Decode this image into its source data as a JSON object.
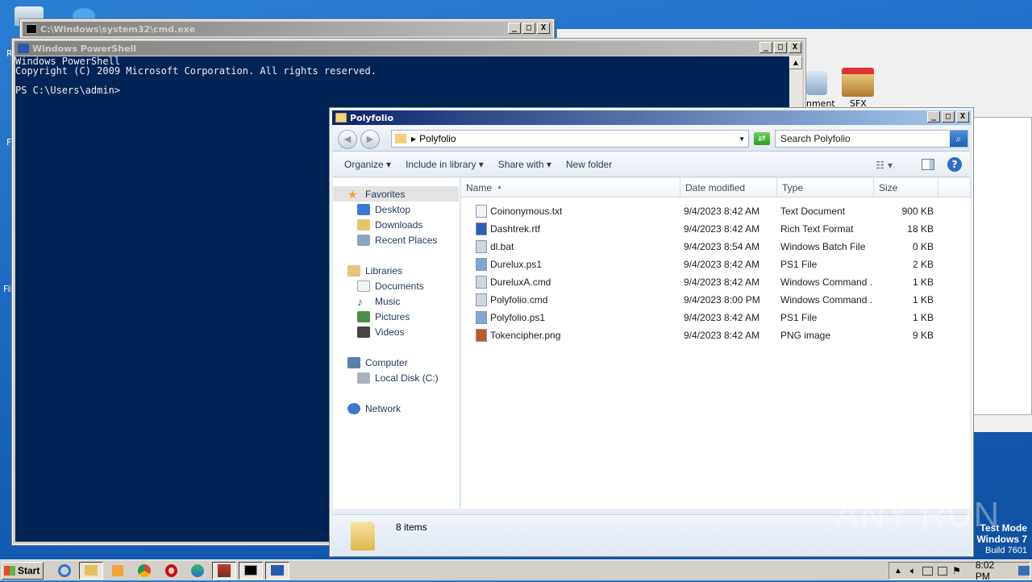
{
  "desktop": {
    "icon_labels": [
      "SFX",
      "nment"
    ],
    "left_fragments": [
      "R",
      "F",
      "Fil"
    ]
  },
  "cmd_window": {
    "title": "C:\\Windows\\system32\\cmd.exe",
    "buttons": [
      "_",
      "□",
      "X"
    ]
  },
  "powershell": {
    "title": "Windows PowerShell",
    "lines": [
      "Windows PowerShell",
      "Copyright (C) 2009 Microsoft Corporation. All rights reserved.",
      "",
      "PS C:\\Users\\admin>"
    ]
  },
  "explorer": {
    "title": "Polyfolio",
    "address": "Polyfolio",
    "search_placeholder": "Search Polyfolio",
    "toolbar": {
      "organize": "Organize",
      "include": "Include in library",
      "share": "Share with",
      "new_folder": "New folder"
    },
    "nav": {
      "favorites": "Favorites",
      "desktop": "Desktop",
      "downloads": "Downloads",
      "recent": "Recent Places",
      "libraries": "Libraries",
      "documents": "Documents",
      "music": "Music",
      "pictures": "Pictures",
      "videos": "Videos",
      "computer": "Computer",
      "local_disk": "Local Disk (C:)",
      "network": "Network"
    },
    "columns": [
      "Name",
      "Date modified",
      "Type",
      "Size"
    ],
    "files": [
      {
        "name": "Coinonymous.txt",
        "date": "9/4/2023 8:42 AM",
        "type": "Text Document",
        "size": "900 KB",
        "icon": "text-file-icon"
      },
      {
        "name": "Dashtrek.rtf",
        "date": "9/4/2023 8:42 AM",
        "type": "Rich Text Format",
        "size": "18 KB",
        "icon": "rtf-file-icon"
      },
      {
        "name": "dl.bat",
        "date": "9/4/2023 8:54 AM",
        "type": "Windows Batch File",
        "size": "0 KB",
        "icon": "batch-file-icon"
      },
      {
        "name": "Durelux.ps1",
        "date": "9/4/2023 8:42 AM",
        "type": "PS1 File",
        "size": "2 KB",
        "icon": "ps1-file-icon"
      },
      {
        "name": "DureluxA.cmd",
        "date": "9/4/2023 8:42 AM",
        "type": "Windows Command ...",
        "size": "1 KB",
        "icon": "cmd-file-icon"
      },
      {
        "name": "Polyfolio.cmd",
        "date": "9/4/2023 8:00 PM",
        "type": "Windows Command ...",
        "size": "1 KB",
        "icon": "cmd-file-icon"
      },
      {
        "name": "Polyfolio.ps1",
        "date": "9/4/2023 8:42 AM",
        "type": "PS1 File",
        "size": "1 KB",
        "icon": "ps1-file-icon"
      },
      {
        "name": "Tokencipher.png",
        "date": "9/4/2023 8:42 AM",
        "type": "PNG image",
        "size": "9 KB",
        "icon": "png-file-icon"
      }
    ],
    "status_count": "8 items"
  },
  "taskbar": {
    "start": "Start",
    "clock": "8:02 PM"
  },
  "watermark": {
    "line1": "Test Mode",
    "line2": "Windows 7",
    "line3": "Build 7601",
    "brand": "ANY RUN"
  }
}
